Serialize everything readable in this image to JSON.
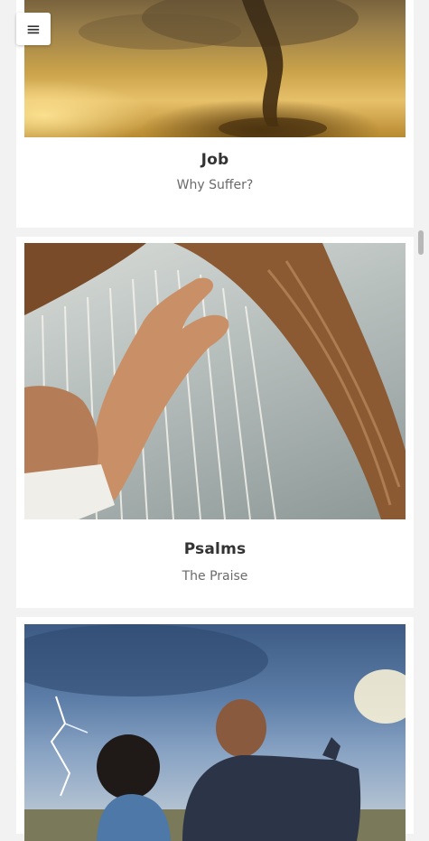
{
  "menu": {
    "icon": "hamburger-menu-icon",
    "glyph": "≡"
  },
  "cards": [
    {
      "title": "Job",
      "subtitle": "Why Suffer?",
      "image": "tornado-over-golden-field"
    },
    {
      "title": "Psalms",
      "subtitle": "The Praise",
      "image": "hands-playing-harp"
    },
    {
      "title": "",
      "subtitle": "",
      "image": "man-and-boy-pointing-at-stormy-sky"
    }
  ]
}
